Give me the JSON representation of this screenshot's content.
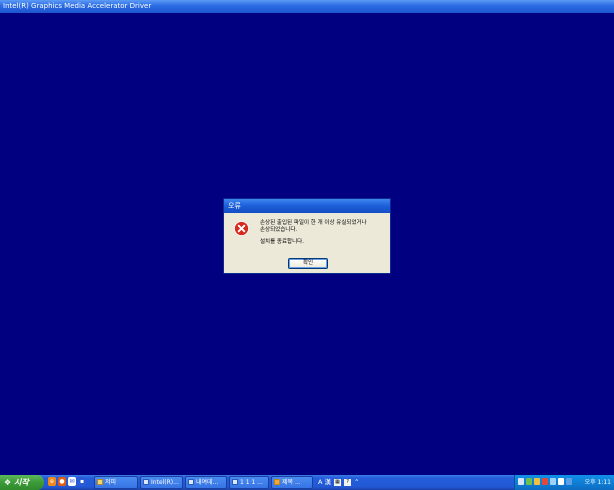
{
  "installer": {
    "title": "Intel(R) Graphics Media Accelerator Driver"
  },
  "dialog": {
    "title": "오류",
    "message_line1": "손상된 출입된 파일이 한 개 이상 유실되었거나",
    "message_line2": "손상되었습니다.",
    "message_line3": "설치를 종료합니다.",
    "ok_label": "확인",
    "icon": "error-icon"
  },
  "taskbar": {
    "start_label": "시작",
    "quick_launch": [
      "ie-icon",
      "firefox-icon",
      "outlook-icon",
      "show-desktop-icon"
    ],
    "tasks": [
      {
        "label": "저피",
        "icon": "folder-icon"
      },
      {
        "label": "Intel(R)...",
        "icon": "window-icon"
      },
      {
        "label": "내여데...",
        "icon": "window-icon"
      },
      {
        "label": "1 1 1 ...",
        "icon": "window-icon"
      },
      {
        "label": "제목 ...",
        "icon": "paint-icon"
      }
    ],
    "language_bar": "A 漢",
    "clock": "오후 1:11"
  }
}
